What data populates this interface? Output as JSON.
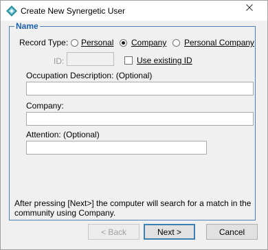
{
  "window": {
    "title": "Create New Synergetic User",
    "close_icon": "close-icon"
  },
  "group": {
    "legend": "Name"
  },
  "record_type": {
    "label": "Record Type:",
    "options": [
      {
        "label": "Personal",
        "selected": false
      },
      {
        "label": "Company",
        "selected": true
      },
      {
        "label": "Personal Company",
        "selected": false
      }
    ]
  },
  "id_field": {
    "label": "ID:",
    "value": ""
  },
  "use_existing": {
    "label": "Use existing ID",
    "checked": false
  },
  "occupation": {
    "label": "Occupation Description: (Optional)",
    "value": ""
  },
  "company": {
    "label": "Company:",
    "value": ""
  },
  "attention": {
    "label": "Attention:  (Optional)",
    "value": ""
  },
  "info": {
    "line1": "After pressing [Next>] the computer will search for a match in the",
    "line2": "community using Company."
  },
  "buttons": {
    "back": "< Back",
    "next": "Next >",
    "cancel": "Cancel"
  },
  "colors": {
    "accent": "#1b5fb0",
    "group_border": "#4a7cc0",
    "background": "#f0f0f0"
  }
}
